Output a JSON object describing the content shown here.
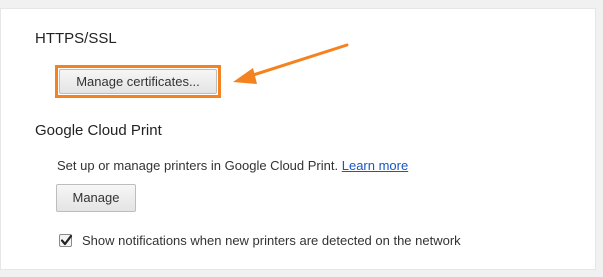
{
  "https": {
    "title": "HTTPS/SSL",
    "manage_certificates_label": "Manage certificates..."
  },
  "cloud_print": {
    "title": "Google Cloud Print",
    "description": "Set up or manage printers in Google Cloud Print.",
    "learn_more_label": "Learn more",
    "manage_label": "Manage",
    "notifications_label": "Show notifications when new printers are detected on the network",
    "notifications_checked": true
  },
  "annotation": {
    "highlight_color": "#f58220",
    "arrow_color": "#f58220"
  }
}
